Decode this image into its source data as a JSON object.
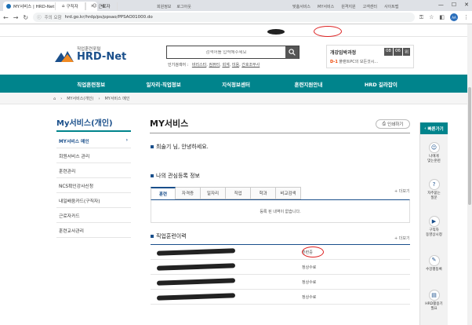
{
  "browser": {
    "tab_title": "MY서비스 | HRD-Net",
    "tab_close": "×",
    "new_tab": "+",
    "window_controls": [
      "—",
      "☐",
      "✕"
    ],
    "url_security": "주의 요함",
    "url": "hrd.go.kr/hrdp/ps/ppsao/PPSAO01000.do",
    "profile_initial": "AA"
  },
  "util": {
    "individual": "구직자",
    "business": "근로자",
    "mid_links": [
      "회원정보",
      "로그아웃"
    ],
    "right_links": [
      "맞춤서비스",
      "MY서비스",
      "원격지원",
      "고객센터",
      "사이트맵"
    ]
  },
  "header": {
    "logo_sub": "직업훈련포털",
    "logo_main": "HRD-Net",
    "search_placeholder": "검색어를 입력해주세요",
    "popular_label": "인기검색어 :",
    "popular_keywords": [
      "바리스타",
      "컴퓨터",
      "회계",
      "미용",
      "간호조무사"
    ],
    "notice_title": "개강임박과정",
    "notice_dates": [
      "08",
      "06",
      "위"
    ],
    "notice_dday": "D-1",
    "notice_text": "플랜트PC의 모든것시..."
  },
  "gnb": [
    "직업훈련정보",
    "일자리·직업정보",
    "지식정보센터",
    "훈련지원안내",
    "HRD 길라잡이"
  ],
  "breadcrumb": [
    "MY서비스(개인)",
    "MY서비스 메인"
  ],
  "lnb": {
    "title": "My서비스(개인)",
    "items": [
      "MY서비스 메인",
      "회원서비스 관리",
      "훈련관리",
      "NCS확인강사신청",
      "내일배움카드(구직자)",
      "근로자카드",
      "훈련교사관리"
    ]
  },
  "main": {
    "title": "MY서비스",
    "print": "인쇄하기",
    "greeting": "최술기 님, 안녕하세요.",
    "interest_title": "나의 관심등록 정보",
    "more": "+ 더보기",
    "tabs": [
      "훈련",
      "자격증",
      "일자리",
      "직업",
      "학과",
      "비교검색"
    ],
    "empty": "등록 된 내역이 없습니다.",
    "history_title": "직업훈련이력",
    "history_status": [
      "훈련중",
      "정상수료",
      "정상수료",
      "정상수료"
    ]
  },
  "quick": {
    "header": "빠른가기",
    "items": [
      "나에게\n맞는훈련",
      "자주묻는\n질문",
      "구직자\n동영상시청",
      "수강평등록",
      "HRD활용기\n필요"
    ]
  },
  "colors": {
    "teal": "#00848c",
    "navy": "#1a4f8b",
    "annotation": "#dd2222"
  }
}
